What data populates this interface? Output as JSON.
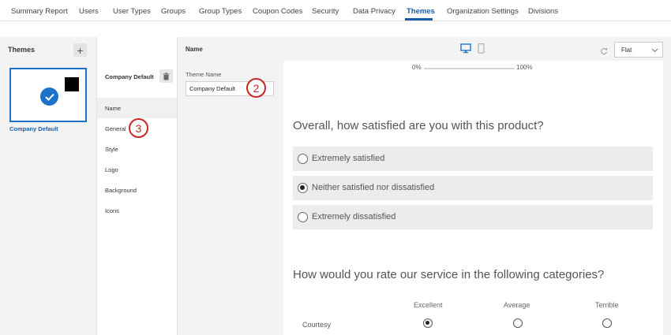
{
  "nav": {
    "tabs": [
      {
        "label": "Summary Report"
      },
      {
        "label": "Users"
      },
      {
        "label": "User Types"
      },
      {
        "label": "Groups"
      },
      {
        "label": "Group Types"
      },
      {
        "label": "Coupon Codes"
      },
      {
        "label": "Security"
      },
      {
        "label": "Data Privacy"
      },
      {
        "label": "Themes",
        "active": true
      },
      {
        "label": "Organization Settings"
      },
      {
        "label": "Divisions"
      }
    ]
  },
  "themes_panel": {
    "title": "Themes",
    "add_label": "+",
    "selected_theme": "Company Default",
    "accent_color": "#1a73c9"
  },
  "theme_menu": {
    "theme_name": "Company Default",
    "items": [
      "Name",
      "General",
      "Style",
      "Logo",
      "Background",
      "Icons"
    ],
    "selected": "Name"
  },
  "name_panel": {
    "header": "Name",
    "field_label": "Theme Name",
    "field_value": "Company Default"
  },
  "callouts": {
    "two": "2",
    "three": "3",
    "color": "#c62828"
  },
  "preview": {
    "layout_select": "Flat",
    "progress_start": "0%",
    "progress_end": "100%",
    "question1": "Overall, how satisfied are you with this product?",
    "choices": [
      {
        "label": "Extremely satisfied",
        "selected": false
      },
      {
        "label": "Neither satisfied nor dissatisfied",
        "selected": true
      },
      {
        "label": "Extremely dissatisfied",
        "selected": false
      }
    ],
    "question2": "How would you rate our service in the following categories?",
    "matrix_columns": [
      "Excellent",
      "Average",
      "Terrible"
    ],
    "matrix_row": "Courtesy",
    "matrix_selected": "Excellent"
  }
}
